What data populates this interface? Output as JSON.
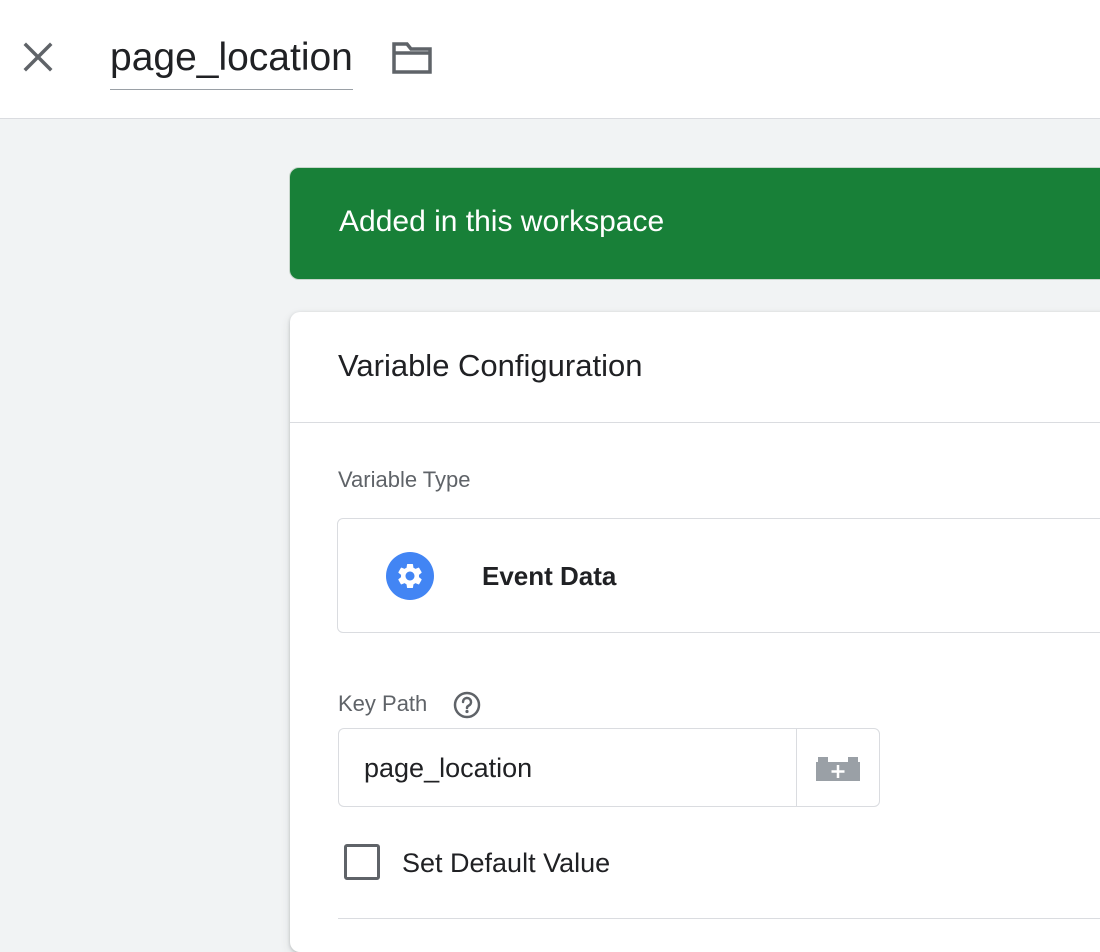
{
  "header": {
    "title": "page_location"
  },
  "banner": {
    "text": "Added in this workspace",
    "color": "#188038"
  },
  "card": {
    "title": "Variable Configuration",
    "variable_type_label": "Variable Type",
    "variable_type": {
      "name": "Event Data",
      "icon": "gear-icon",
      "icon_color": "#4285f4"
    },
    "key_path": {
      "label": "Key Path",
      "value": "page_location",
      "help_icon": "help-icon",
      "picker_icon": "variable-picker-icon"
    },
    "default_value": {
      "label": "Set Default Value",
      "checked": false
    }
  }
}
